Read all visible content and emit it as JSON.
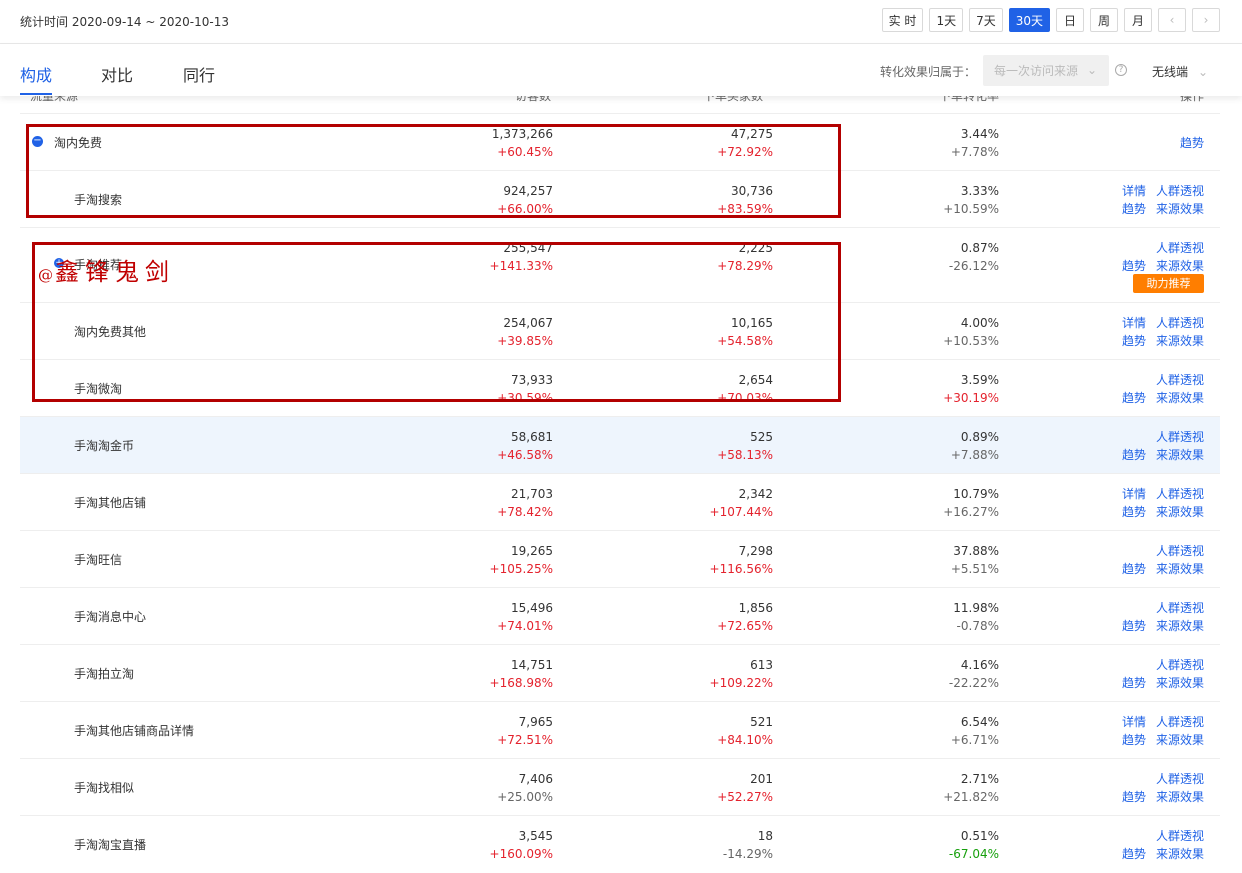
{
  "header": {
    "stat_time": "统计时间 2020-09-14 ~ 2020-10-13",
    "periods": [
      "实 时",
      "1天",
      "7天",
      "30天",
      "日",
      "周",
      "月"
    ],
    "active_period": "30天",
    "prev_icon": "chevron-left-icon",
    "next_icon": "chevron-right-icon"
  },
  "tabs": {
    "items": [
      "构成",
      "对比",
      "同行"
    ],
    "active": "构成",
    "attribution_label": "转化效果归属于：",
    "attribution_value": "每一次访问来源",
    "device_value": "无线端"
  },
  "columns": [
    "流量来源",
    "访客数",
    "下单买家数",
    "下单转化率",
    "操作"
  ],
  "accent_color": "#2062e6",
  "rows": [
    {
      "name": "淘内免费",
      "visitors": "1,373,266",
      "visitors_delta": "+60.45%",
      "buyers": "47,275",
      "buyers_delta": "+72.92%",
      "rate": "3.44%",
      "rate_delta": "+7.78%",
      "ops": [
        "趋势"
      ]
    },
    {
      "name": "手淘搜索",
      "visitors": "924,257",
      "visitors_delta": "+66.00%",
      "buyers": "30,736",
      "buyers_delta": "+83.59%",
      "rate": "3.33%",
      "rate_delta": "+10.59%",
      "ops": [
        "详情",
        "人群透视",
        "趋势",
        "来源效果"
      ]
    },
    {
      "name": "手淘推荐",
      "visitors": "255,547",
      "visitors_delta": "+141.33%",
      "buyers": "2,225",
      "buyers_delta": "+78.29%",
      "rate": "0.87%",
      "rate_delta": "-26.12%",
      "ops": [
        "人群透视",
        "趋势",
        "来源效果"
      ],
      "badge": "助力推荐"
    },
    {
      "name": "淘内免费其他",
      "visitors": "254,067",
      "visitors_delta": "+39.85%",
      "buyers": "10,165",
      "buyers_delta": "+54.58%",
      "rate": "4.00%",
      "rate_delta": "+10.53%",
      "ops": [
        "详情",
        "人群透视",
        "趋势",
        "来源效果"
      ]
    },
    {
      "name": "手淘微淘",
      "visitors": "73,933",
      "visitors_delta": "+30.59%",
      "buyers": "2,654",
      "buyers_delta": "+70.03%",
      "rate": "3.59%",
      "rate_delta": "+30.19%",
      "ops": [
        "人群透视",
        "趋势",
        "来源效果"
      ]
    },
    {
      "name": "手淘淘金币",
      "visitors": "58,681",
      "visitors_delta": "+46.58%",
      "buyers": "525",
      "buyers_delta": "+58.13%",
      "rate": "0.89%",
      "rate_delta": "+7.88%",
      "ops": [
        "人群透视",
        "趋势",
        "来源效果"
      ]
    },
    {
      "name": "手淘其他店铺",
      "visitors": "21,703",
      "visitors_delta": "+78.42%",
      "buyers": "2,342",
      "buyers_delta": "+107.44%",
      "rate": "10.79%",
      "rate_delta": "+16.27%",
      "ops": [
        "详情",
        "人群透视",
        "趋势",
        "来源效果"
      ]
    },
    {
      "name": "手淘旺信",
      "visitors": "19,265",
      "visitors_delta": "+105.25%",
      "buyers": "7,298",
      "buyers_delta": "+116.56%",
      "rate": "37.88%",
      "rate_delta": "+5.51%",
      "ops": [
        "人群透视",
        "趋势",
        "来源效果"
      ]
    },
    {
      "name": "手淘消息中心",
      "visitors": "15,496",
      "visitors_delta": "+74.01%",
      "buyers": "1,856",
      "buyers_delta": "+72.65%",
      "rate": "11.98%",
      "rate_delta": "-0.78%",
      "ops": [
        "人群透视",
        "趋势",
        "来源效果"
      ]
    },
    {
      "name": "手淘拍立淘",
      "visitors": "14,751",
      "visitors_delta": "+168.98%",
      "buyers": "613",
      "buyers_delta": "+109.22%",
      "rate": "4.16%",
      "rate_delta": "-22.22%",
      "ops": [
        "人群透视",
        "趋势",
        "来源效果"
      ]
    },
    {
      "name": "手淘其他店铺商品详情",
      "visitors": "7,965",
      "visitors_delta": "+72.51%",
      "buyers": "521",
      "buyers_delta": "+84.10%",
      "rate": "6.54%",
      "rate_delta": "+6.71%",
      "ops": [
        "详情",
        "人群透视",
        "趋势",
        "来源效果"
      ]
    },
    {
      "name": "手淘找相似",
      "visitors": "7,406",
      "visitors_delta": "+25.00%",
      "buyers": "201",
      "buyers_delta": "+52.27%",
      "rate": "2.71%",
      "rate_delta": "+21.82%",
      "ops": [
        "人群透视",
        "趋势",
        "来源效果"
      ]
    },
    {
      "name": "手淘淘宝直播",
      "visitors": "3,545",
      "visitors_delta": "+160.09%",
      "buyers": "18",
      "buyers_delta": "-14.29%",
      "rate": "0.51%",
      "rate_delta": "-67.04%",
      "ops": [
        "人群透视",
        "趋势",
        "来源效果"
      ]
    }
  ],
  "watermark": {
    "at": "@",
    "text": "鑫锋鬼剑"
  }
}
